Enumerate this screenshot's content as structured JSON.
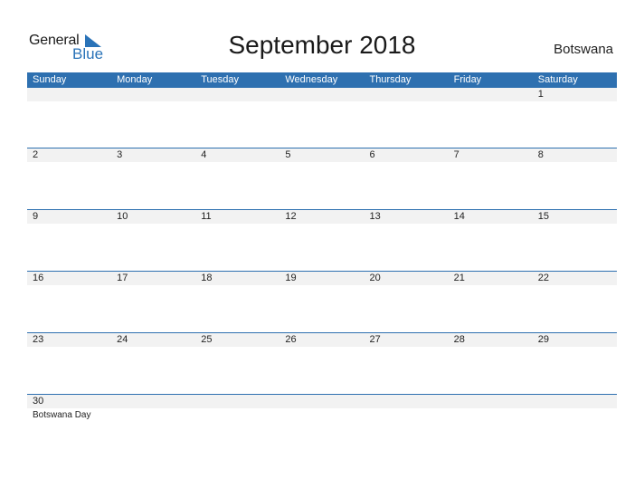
{
  "logo": {
    "line1": "General",
    "line2": "Blue"
  },
  "title": "September 2018",
  "country": "Botswana",
  "colors": {
    "accent": "#2e70b0",
    "date_strip": "#f2f2f2"
  },
  "weekdays": [
    "Sunday",
    "Monday",
    "Tuesday",
    "Wednesday",
    "Thursday",
    "Friday",
    "Saturday"
  ],
  "weeks": [
    {
      "days": [
        "",
        "",
        "",
        "",
        "",
        "",
        "1"
      ],
      "events": [
        "",
        "",
        "",
        "",
        "",
        "",
        ""
      ]
    },
    {
      "days": [
        "2",
        "3",
        "4",
        "5",
        "6",
        "7",
        "8"
      ],
      "events": [
        "",
        "",
        "",
        "",
        "",
        "",
        ""
      ]
    },
    {
      "days": [
        "9",
        "10",
        "11",
        "12",
        "13",
        "14",
        "15"
      ],
      "events": [
        "",
        "",
        "",
        "",
        "",
        "",
        ""
      ]
    },
    {
      "days": [
        "16",
        "17",
        "18",
        "19",
        "20",
        "21",
        "22"
      ],
      "events": [
        "",
        "",
        "",
        "",
        "",
        "",
        ""
      ]
    },
    {
      "days": [
        "23",
        "24",
        "25",
        "26",
        "27",
        "28",
        "29"
      ],
      "events": [
        "",
        "",
        "",
        "",
        "",
        "",
        ""
      ]
    },
    {
      "days": [
        "30",
        "",
        "",
        "",
        "",
        "",
        ""
      ],
      "events": [
        "Botswana Day",
        "",
        "",
        "",
        "",
        "",
        ""
      ]
    }
  ]
}
